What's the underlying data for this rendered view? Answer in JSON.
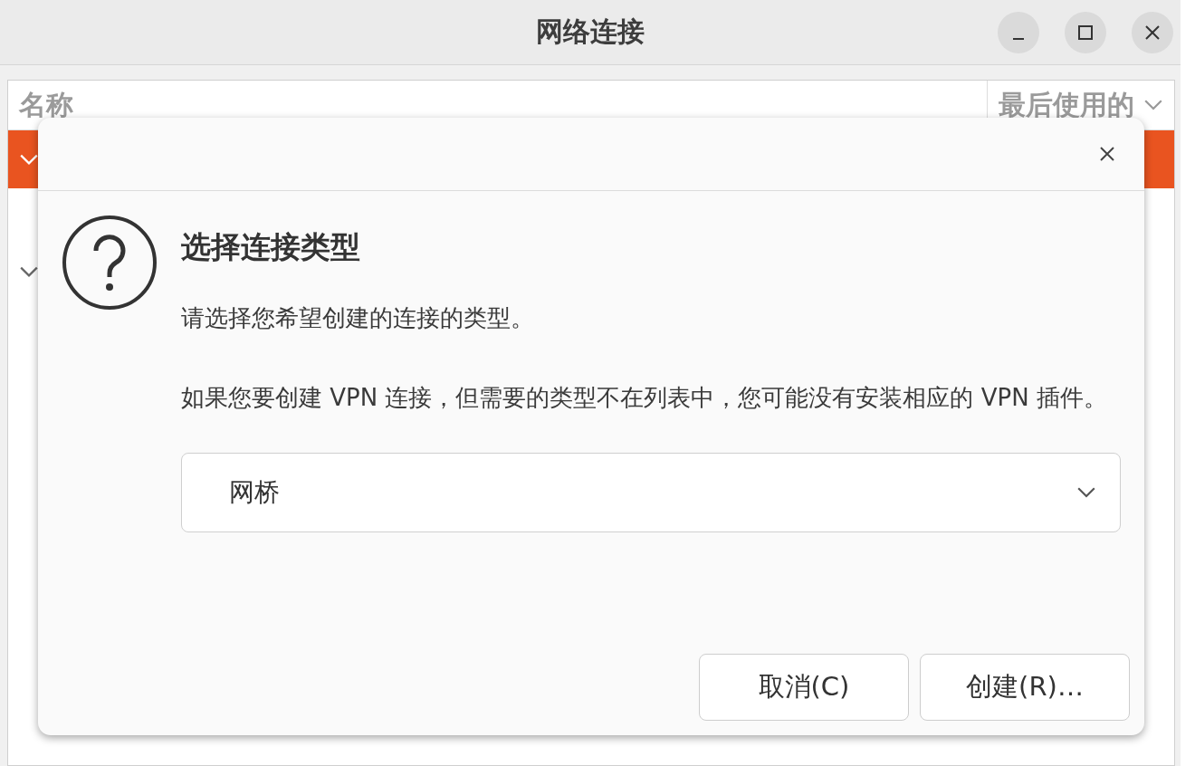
{
  "window": {
    "title": "网络连接",
    "controls": [
      {
        "kind": "minimize"
      },
      {
        "kind": "maximize"
      },
      {
        "kind": "close"
      }
    ]
  },
  "list": {
    "columns": [
      {
        "label": "名称",
        "sortable": false
      },
      {
        "label": "最后使用的",
        "sortable": true
      }
    ],
    "rows": [
      {
        "selected": true,
        "expanded": true
      },
      {
        "selected": false,
        "expanded": true
      }
    ]
  },
  "dialog": {
    "title": "选择连接类型",
    "description": "请选择您希望创建的连接的类型。",
    "note": "如果您要创建 VPN 连接，但需要的类型不在列表中，您可能没有安装相应的 VPN 插件。",
    "dropdown": {
      "value": "网桥"
    },
    "buttons": [
      {
        "label": "取消(C)"
      },
      {
        "label": "创建(R)…"
      }
    ]
  }
}
